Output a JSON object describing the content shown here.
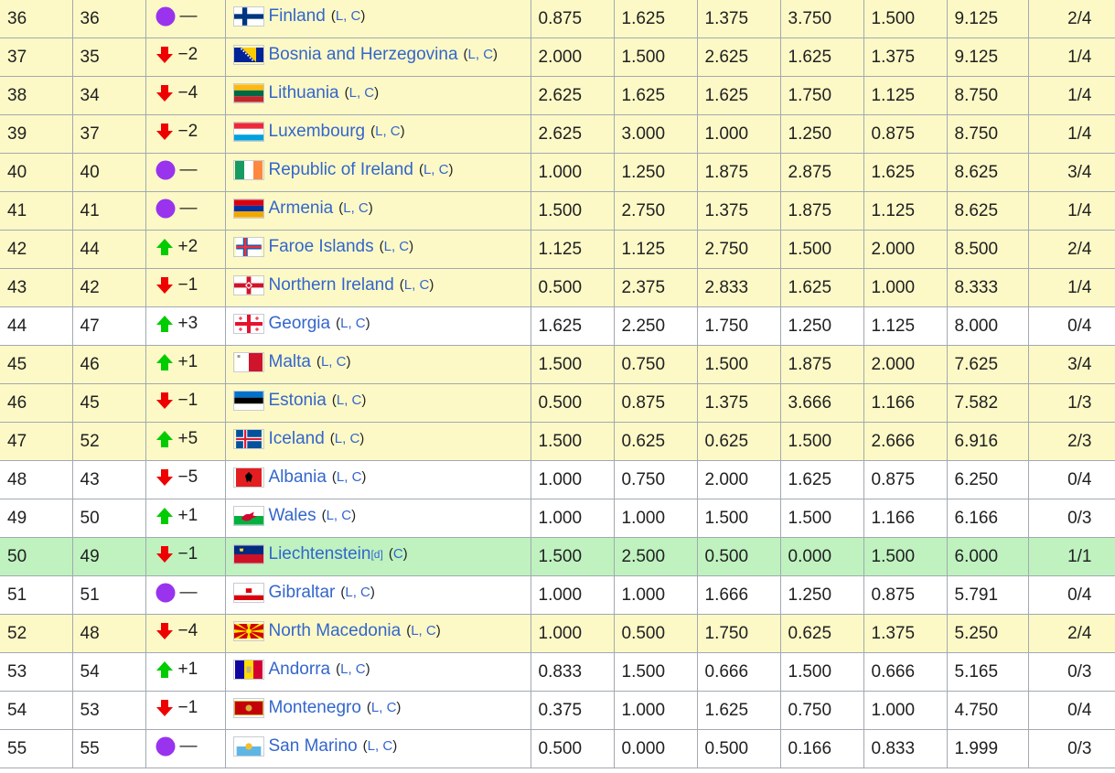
{
  "table": {
    "rows": [
      {
        "rank": "36",
        "prev": "36",
        "move": "same",
        "change": "—",
        "flag": "finland-flag-icon",
        "nation": "Finland",
        "note": "L, C",
        "v1": "0.875",
        "v2": "1.625",
        "v3": "1.375",
        "v4": "3.750",
        "v5": "1.500",
        "total": "9.125",
        "teams": "2/4",
        "bg": "yellow"
      },
      {
        "rank": "37",
        "prev": "35",
        "move": "down",
        "change": "−2",
        "flag": "bosnia-and-herzegovina-flag-icon",
        "nation": "Bosnia and Herzegovina",
        "note": "L, C",
        "v1": "2.000",
        "v2": "1.500",
        "v3": "2.625",
        "v4": "1.625",
        "v5": "1.375",
        "total": "9.125",
        "teams": "1/4",
        "bg": "yellow"
      },
      {
        "rank": "38",
        "prev": "34",
        "move": "down",
        "change": "−4",
        "flag": "lithuania-flag-icon",
        "nation": "Lithuania",
        "note": "L, C",
        "v1": "2.625",
        "v2": "1.625",
        "v3": "1.625",
        "v4": "1.750",
        "v5": "1.125",
        "total": "8.750",
        "teams": "1/4",
        "bg": "yellow"
      },
      {
        "rank": "39",
        "prev": "37",
        "move": "down",
        "change": "−2",
        "flag": "luxembourg-flag-icon",
        "nation": "Luxembourg",
        "note": "L, C",
        "v1": "2.625",
        "v2": "3.000",
        "v3": "1.000",
        "v4": "1.250",
        "v5": "0.875",
        "total": "8.750",
        "teams": "1/4",
        "bg": "yellow"
      },
      {
        "rank": "40",
        "prev": "40",
        "move": "same",
        "change": "—",
        "flag": "ireland-flag-icon",
        "nation": "Republic of Ireland",
        "note": "L, C",
        "v1": "1.000",
        "v2": "1.250",
        "v3": "1.875",
        "v4": "2.875",
        "v5": "1.625",
        "total": "8.625",
        "teams": "3/4",
        "bg": "yellow"
      },
      {
        "rank": "41",
        "prev": "41",
        "move": "same",
        "change": "—",
        "flag": "armenia-flag-icon",
        "nation": "Armenia",
        "note": "L, C",
        "v1": "1.500",
        "v2": "2.750",
        "v3": "1.375",
        "v4": "1.875",
        "v5": "1.125",
        "total": "8.625",
        "teams": "1/4",
        "bg": "yellow"
      },
      {
        "rank": "42",
        "prev": "44",
        "move": "up",
        "change": "+2",
        "flag": "faroe-islands-flag-icon",
        "nation": "Faroe Islands",
        "note": "L, C",
        "v1": "1.125",
        "v2": "1.125",
        "v3": "2.750",
        "v4": "1.500",
        "v5": "2.000",
        "total": "8.500",
        "teams": "2/4",
        "bg": "yellow"
      },
      {
        "rank": "43",
        "prev": "42",
        "move": "down",
        "change": "−1",
        "flag": "northern-ireland-flag-icon",
        "nation": "Northern Ireland",
        "note": "L, C",
        "v1": "0.500",
        "v2": "2.375",
        "v3": "2.833",
        "v4": "1.625",
        "v5": "1.000",
        "total": "8.333",
        "teams": "1/4",
        "bg": "yellow"
      },
      {
        "rank": "44",
        "prev": "47",
        "move": "up",
        "change": "+3",
        "flag": "georgia-flag-icon",
        "nation": "Georgia",
        "note": "L, C",
        "v1": "1.625",
        "v2": "2.250",
        "v3": "1.750",
        "v4": "1.250",
        "v5": "1.125",
        "total": "8.000",
        "teams": "0/4",
        "bg": "white"
      },
      {
        "rank": "45",
        "prev": "46",
        "move": "up",
        "change": "+1",
        "flag": "malta-flag-icon",
        "nation": "Malta",
        "note": "L, C",
        "v1": "1.500",
        "v2": "0.750",
        "v3": "1.500",
        "v4": "1.875",
        "v5": "2.000",
        "total": "7.625",
        "teams": "3/4",
        "bg": "yellow"
      },
      {
        "rank": "46",
        "prev": "45",
        "move": "down",
        "change": "−1",
        "flag": "estonia-flag-icon",
        "nation": "Estonia",
        "note": "L, C",
        "v1": "0.500",
        "v2": "0.875",
        "v3": "1.375",
        "v4": "3.666",
        "v5": "1.166",
        "total": "7.582",
        "teams": "1/3",
        "bg": "yellow"
      },
      {
        "rank": "47",
        "prev": "52",
        "move": "up",
        "change": "+5",
        "flag": "iceland-flag-icon",
        "nation": "Iceland",
        "note": "L, C",
        "v1": "1.500",
        "v2": "0.625",
        "v3": "0.625",
        "v4": "1.500",
        "v5": "2.666",
        "total": "6.916",
        "teams": "2/3",
        "bg": "yellow"
      },
      {
        "rank": "48",
        "prev": "43",
        "move": "down",
        "change": "−5",
        "flag": "albania-flag-icon",
        "nation": "Albania",
        "note": "L, C",
        "v1": "1.000",
        "v2": "0.750",
        "v3": "2.000",
        "v4": "1.625",
        "v5": "0.875",
        "total": "6.250",
        "teams": "0/4",
        "bg": "white"
      },
      {
        "rank": "49",
        "prev": "50",
        "move": "up",
        "change": "+1",
        "flag": "wales-flag-icon",
        "nation": "Wales",
        "note": "L, C",
        "v1": "1.000",
        "v2": "1.000",
        "v3": "1.500",
        "v4": "1.500",
        "v5": "1.166",
        "total": "6.166",
        "teams": "0/3",
        "bg": "white"
      },
      {
        "rank": "50",
        "prev": "49",
        "move": "down",
        "change": "−1",
        "flag": "liechtenstein-flag-icon",
        "nation": "Liechtenstein",
        "note": "C",
        "ref": "[d]",
        "v1": "1.500",
        "v2": "2.500",
        "v3": "0.500",
        "v4": "0.000",
        "v5": "1.500",
        "total": "6.000",
        "teams": "1/1",
        "bg": "green"
      },
      {
        "rank": "51",
        "prev": "51",
        "move": "same",
        "change": "—",
        "flag": "gibraltar-flag-icon",
        "nation": "Gibraltar",
        "note": "L, C",
        "v1": "1.000",
        "v2": "1.000",
        "v3": "1.666",
        "v4": "1.250",
        "v5": "0.875",
        "total": "5.791",
        "teams": "0/4",
        "bg": "white"
      },
      {
        "rank": "52",
        "prev": "48",
        "move": "down",
        "change": "−4",
        "flag": "north-macedonia-flag-icon",
        "nation": "North Macedonia",
        "note": "L, C",
        "v1": "1.000",
        "v2": "0.500",
        "v3": "1.750",
        "v4": "0.625",
        "v5": "1.375",
        "total": "5.250",
        "teams": "2/4",
        "bg": "yellow"
      },
      {
        "rank": "53",
        "prev": "54",
        "move": "up",
        "change": "+1",
        "flag": "andorra-flag-icon",
        "nation": "Andorra",
        "note": "L, C",
        "v1": "0.833",
        "v2": "1.500",
        "v3": "0.666",
        "v4": "1.500",
        "v5": "0.666",
        "total": "5.165",
        "teams": "0/3",
        "bg": "white"
      },
      {
        "rank": "54",
        "prev": "53",
        "move": "down",
        "change": "−1",
        "flag": "montenegro-flag-icon",
        "nation": "Montenegro",
        "note": "L, C",
        "v1": "0.375",
        "v2": "1.000",
        "v3": "1.625",
        "v4": "0.750",
        "v5": "1.000",
        "total": "4.750",
        "teams": "0/4",
        "bg": "white"
      },
      {
        "rank": "55",
        "prev": "55",
        "move": "same",
        "change": "—",
        "flag": "san-marino-flag-icon",
        "nation": "San Marino",
        "note": "L, C",
        "v1": "0.500",
        "v2": "0.000",
        "v3": "0.500",
        "v4": "0.166",
        "v5": "0.833",
        "total": "1.999",
        "teams": "0/3",
        "bg": "white"
      }
    ]
  },
  "colors": {
    "link": "#3366cc",
    "row_yellow": "#fdf9c6",
    "row_white": "#ffffff",
    "row_green": "#bff2bf",
    "arrow_up": "#00cc00",
    "arrow_down": "#ee0000",
    "no_change": "#9933ee",
    "border": "#a2a9b1"
  }
}
